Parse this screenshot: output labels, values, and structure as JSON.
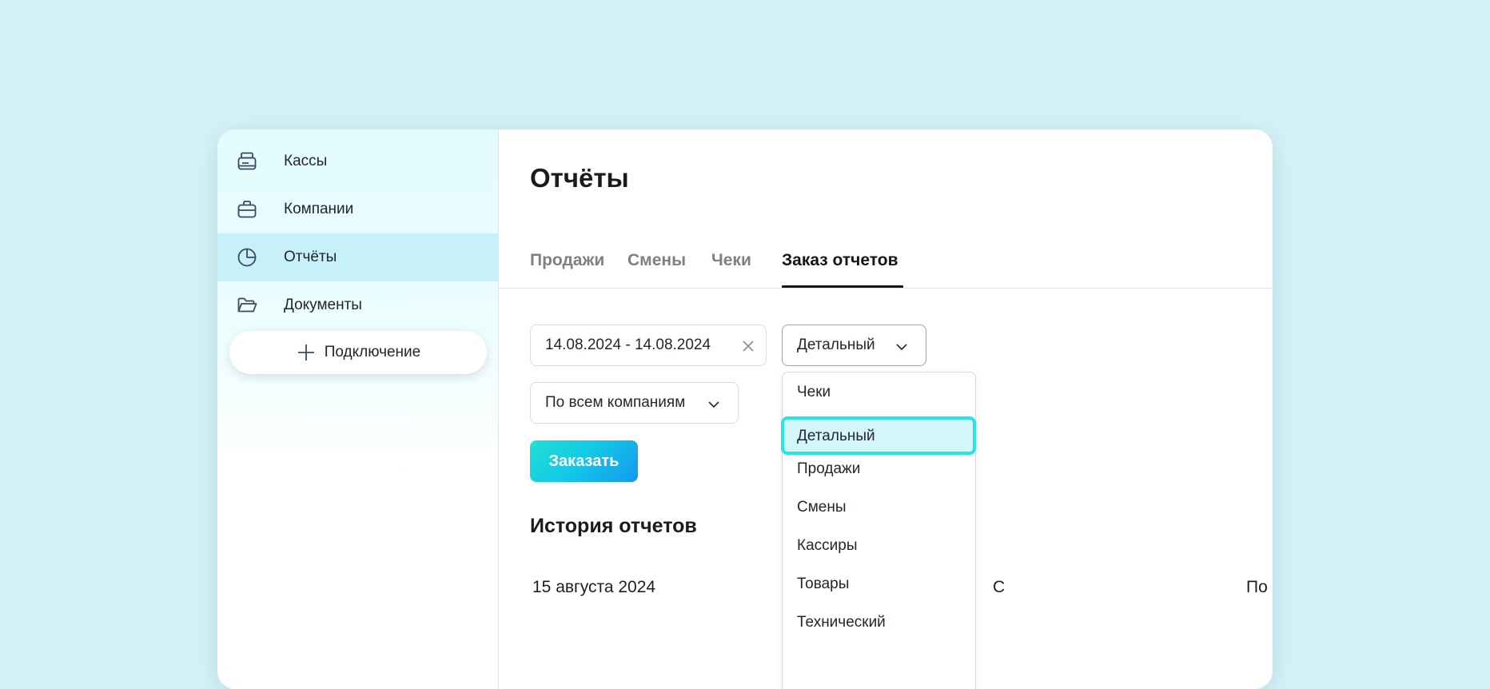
{
  "sidebar": {
    "items": [
      {
        "label": "Кассы",
        "icon": "cash-register-icon"
      },
      {
        "label": "Компании",
        "icon": "briefcase-icon"
      },
      {
        "label": "Отчёты",
        "icon": "pie-chart-icon",
        "active": true
      },
      {
        "label": "Документы",
        "icon": "folder-icon"
      }
    ],
    "connect_label": "Подключение"
  },
  "main": {
    "title": "Отчёты",
    "tabs": [
      {
        "label": "Продажи"
      },
      {
        "label": "Смены"
      },
      {
        "label": "Чеки"
      },
      {
        "label": "Заказ отчетов",
        "active": true
      }
    ],
    "filters": {
      "date_range": "14.08.2024 - 14.08.2024",
      "report_type": "Детальный",
      "company": "По всем компаниям"
    },
    "order_label": "Заказать",
    "history": {
      "title": "История отчетов",
      "rows": [
        {
          "date": "15 августа 2024",
          "type": "С",
          "company": "По всем компаниям"
        }
      ]
    }
  },
  "dropdown": {
    "options": [
      "Чеки",
      "Детальный",
      "Продажи",
      "Смены",
      "Кассиры",
      "Товары",
      "Технический"
    ],
    "selected": "Детальный"
  },
  "colors": {
    "background": "#d4f1f7",
    "active_nav": "#c6f1f8",
    "accent": "#27e3ec",
    "button_gradient_start": "#1fe0d8",
    "button_gradient_end": "#1498f0"
  }
}
